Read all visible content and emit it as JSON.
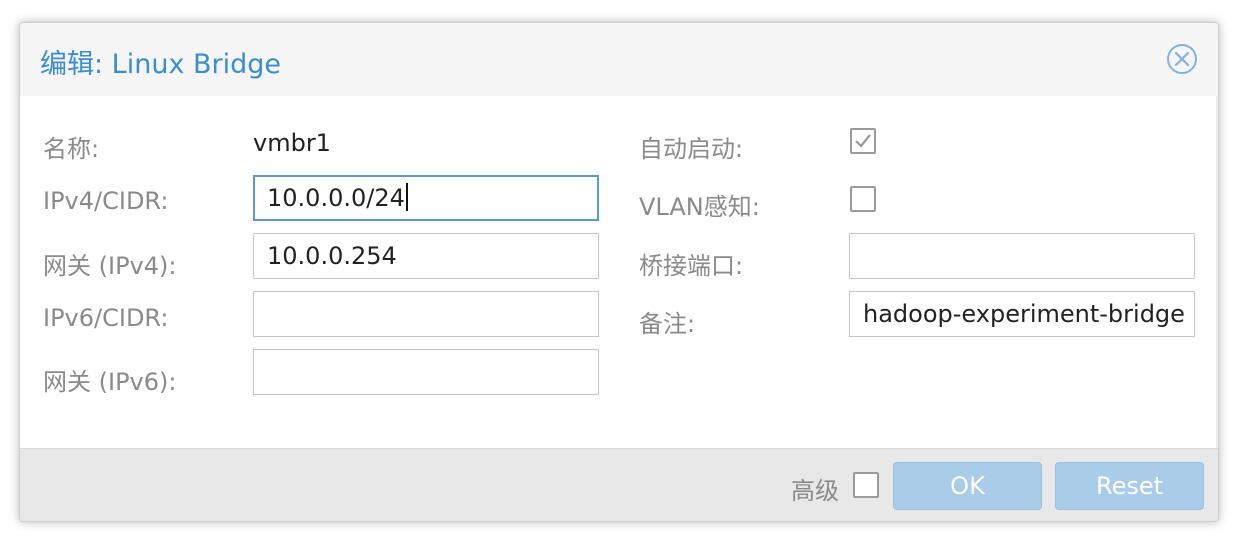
{
  "dialog": {
    "title": "编辑: Linux Bridge",
    "close_icon": "close-circle-icon"
  },
  "left": {
    "name_label": "名称:",
    "name_value": "vmbr1",
    "ipv4_label": "IPv4/CIDR:",
    "ipv4_value": "10.0.0.0/24",
    "gw4_label": "网关 (IPv4):",
    "gw4_value": "10.0.0.254",
    "ipv6_label": "IPv6/CIDR:",
    "ipv6_value": "",
    "gw6_label": "网关 (IPv6):",
    "gw6_value": ""
  },
  "right": {
    "autostart_label": "自动启动:",
    "autostart_checked": true,
    "vlan_label": "VLAN感知:",
    "vlan_checked": false,
    "ports_label": "桥接端口:",
    "ports_value": "",
    "comment_label": "备注:",
    "comment_value": "hadoop-experiment-bridge"
  },
  "footer": {
    "advanced_label": "高级",
    "advanced_checked": false,
    "ok_label": "OK",
    "reset_label": "Reset"
  },
  "colors": {
    "title": "#3a8dd0",
    "button_disabled": "#a9cce8",
    "focus_border": "#5a9ad0"
  }
}
